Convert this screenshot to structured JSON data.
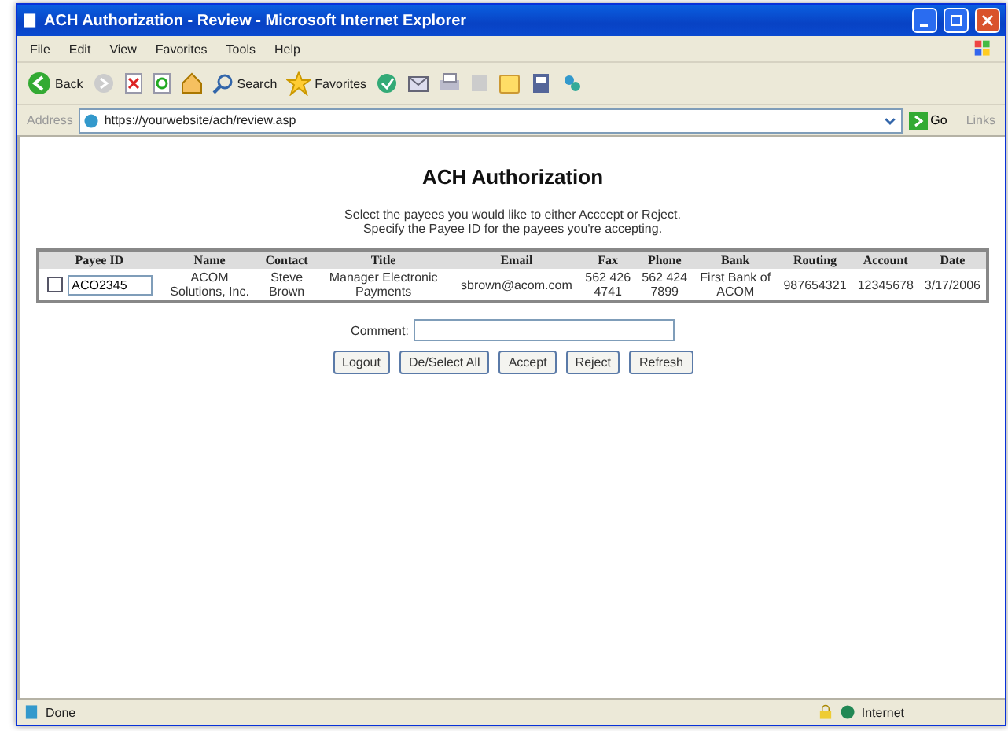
{
  "window": {
    "title": "ACH Authorization - Review - Microsoft Internet Explorer"
  },
  "menu": [
    "File",
    "Edit",
    "View",
    "Favorites",
    "Tools",
    "Help"
  ],
  "toolbar": {
    "back": "Back",
    "search": "Search",
    "favorites": "Favorites"
  },
  "address": {
    "label": "Address",
    "url": "https://yourwebsite/ach/review.asp",
    "go": "Go",
    "links": "Links"
  },
  "page": {
    "heading": "ACH Authorization",
    "instructions": [
      "Select the payees you would like to either Acccept or Reject.",
      "Specify the Payee ID for the payees you're accepting."
    ]
  },
  "table": {
    "columns": [
      "Payee ID",
      "Name",
      "Contact",
      "Title",
      "Email",
      "Fax",
      "Phone",
      "Bank",
      "Routing",
      "Account",
      "Date"
    ],
    "rows": [
      {
        "checked": false,
        "cells": [
          "ACO2345",
          "ACOM Solutions, Inc.",
          "Steve Brown",
          "Manager Electronic Payments",
          "sbrown@acom.com",
          "562 426 4741",
          "562 424 7899",
          "First Bank of ACOM",
          "987654321",
          "12345678",
          "3/17/2006"
        ]
      }
    ]
  },
  "comment": {
    "label": "Comment:"
  },
  "buttons": [
    "Logout",
    "De/Select All",
    "Accept",
    "Reject",
    "Refresh"
  ],
  "status_bar": {
    "text": "Done",
    "zone": "Internet"
  }
}
